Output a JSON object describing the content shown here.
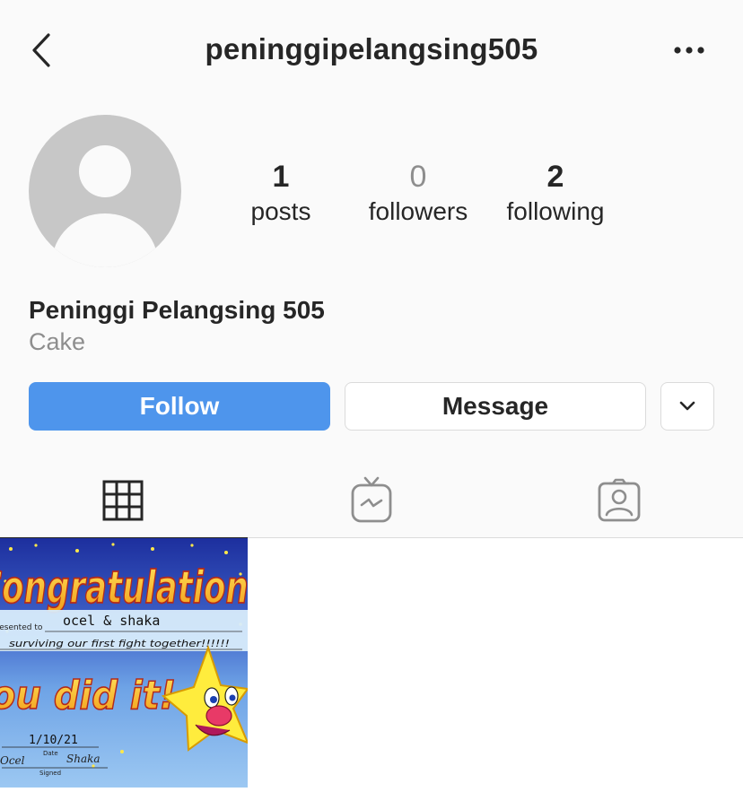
{
  "header": {
    "username": "peninggipelangsing505",
    "back_icon": "chevron-left-icon",
    "more_icon": "ellipsis-icon"
  },
  "profile": {
    "stats": {
      "posts": {
        "count": "1",
        "label": "posts"
      },
      "followers": {
        "count": "0",
        "label": "followers"
      },
      "following": {
        "count": "2",
        "label": "following"
      }
    },
    "display_name": "Peninggi Pelangsing 505",
    "category": "Cake"
  },
  "actions": {
    "follow_label": "Follow",
    "message_label": "Message",
    "more_icon": "chevron-down-icon"
  },
  "tabs": [
    {
      "name": "grid",
      "icon": "grid-icon",
      "active": true
    },
    {
      "name": "igtv",
      "icon": "igtv-icon",
      "active": false
    },
    {
      "name": "tagged",
      "icon": "tagged-person-icon",
      "active": false
    }
  ],
  "posts": [
    {
      "card": {
        "headline": "Congratulations",
        "presented_to_label": "presented to",
        "recipients": "ocel & shaka",
        "reason": "surviving our first fight together!!!!!!",
        "exclaim": "You did it!",
        "date": "1/10/21",
        "date_label": "Date",
        "signed_label": "Signed",
        "signature_1": "Ocel",
        "signature_2": "Shaka"
      }
    }
  ],
  "colors": {
    "follow_button": "#4e95ec",
    "text_primary": "#262626",
    "text_muted": "#8e8e8e",
    "border": "#dbdbdb",
    "background": "#fafafa"
  }
}
